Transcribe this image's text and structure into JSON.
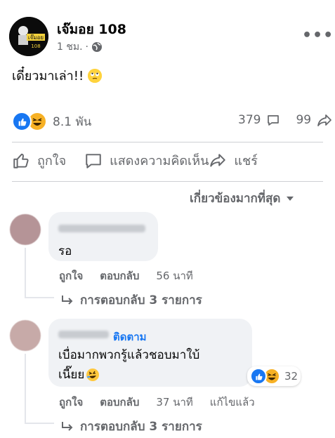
{
  "post": {
    "page_name": "เจ๊มอย 108",
    "time": "1 ชม.",
    "privacy_icon": "globe-icon",
    "text": "เดี๋ยวมาเล่า!!",
    "text_emoji": "eye-roll-emoji",
    "avatar_logo_text": "เจ๊มอย",
    "avatar_logo_sub": "108"
  },
  "stats": {
    "reactions": "8.1 พัน",
    "reaction_icons": [
      "like-icon",
      "haha-icon"
    ],
    "comments": "379",
    "shares": "99"
  },
  "actions": {
    "like": "ถูกใจ",
    "comment": "แสดงความคิดเห็น",
    "share": "แชร์"
  },
  "sort": {
    "label": "เกี่ยวข้องมากที่สุด"
  },
  "comments": [
    {
      "text": "รอ",
      "like": "ถูกใจ",
      "reply": "ตอบกลับ",
      "time": "56 นาที",
      "replies": "การตอบกลับ 3 รายการ"
    },
    {
      "follow": "ติดตาม",
      "text_line1": "เบื่อมากพวกรู้แล้วชอบมาใบ้",
      "text_line2": "เนี๊ยย",
      "reaction_count": "32",
      "like": "ถูกใจ",
      "reply": "ตอบกลับ",
      "time": "37 นาที",
      "edited": "แก้ไขแล้ว",
      "replies": "การตอบกลับ 3 รายการ"
    }
  ],
  "colors": {
    "accent": "#1877f2",
    "muted": "#65676b",
    "bubble": "#f0f2f5"
  }
}
